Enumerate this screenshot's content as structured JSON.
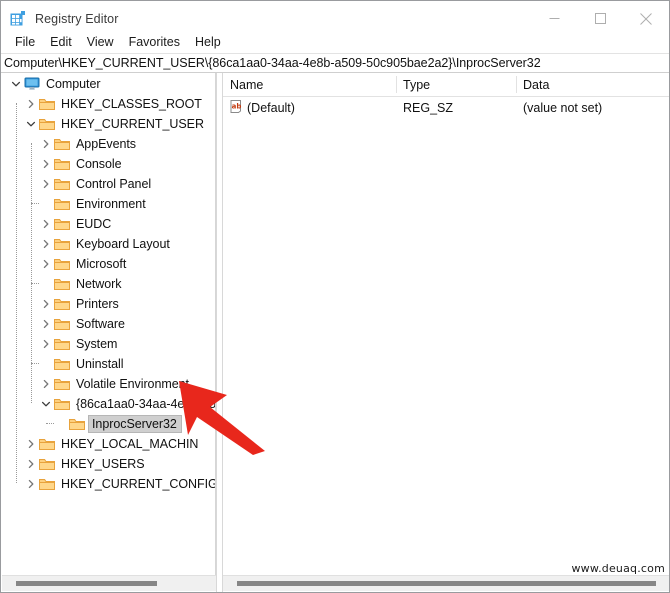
{
  "window": {
    "title": "Registry Editor",
    "app_icon": "registry-grid-icon",
    "minimize_label": "Minimize",
    "maximize_label": "Maximize",
    "close_label": "Close"
  },
  "menu": {
    "items": [
      {
        "label": "File"
      },
      {
        "label": "Edit"
      },
      {
        "label": "View"
      },
      {
        "label": "Favorites"
      },
      {
        "label": "Help"
      }
    ]
  },
  "address": {
    "path": "Computer\\HKEY_CURRENT_USER\\{86ca1aa0-34aa-4e8b-a509-50c905bae2a2}\\InprocServer32"
  },
  "tree": {
    "nodes": [
      {
        "label": "Computer",
        "depth": 0,
        "expander": "expanded",
        "icon": "computer-icon",
        "selected": false
      },
      {
        "label": "HKEY_CLASSES_ROOT",
        "depth": 1,
        "expander": "collapsed",
        "icon": "folder-icon",
        "selected": false
      },
      {
        "label": "HKEY_CURRENT_USER",
        "depth": 1,
        "expander": "expanded",
        "icon": "folder-icon",
        "selected": false
      },
      {
        "label": "AppEvents",
        "depth": 2,
        "expander": "collapsed",
        "icon": "folder-icon",
        "selected": false
      },
      {
        "label": "Console",
        "depth": 2,
        "expander": "collapsed",
        "icon": "folder-icon",
        "selected": false
      },
      {
        "label": "Control Panel",
        "depth": 2,
        "expander": "collapsed",
        "icon": "folder-icon",
        "selected": false
      },
      {
        "label": "Environment",
        "depth": 2,
        "expander": "none",
        "icon": "folder-icon",
        "selected": false
      },
      {
        "label": "EUDC",
        "depth": 2,
        "expander": "collapsed",
        "icon": "folder-icon",
        "selected": false
      },
      {
        "label": "Keyboard Layout",
        "depth": 2,
        "expander": "collapsed",
        "icon": "folder-icon",
        "selected": false
      },
      {
        "label": "Microsoft",
        "depth": 2,
        "expander": "collapsed",
        "icon": "folder-icon",
        "selected": false
      },
      {
        "label": "Network",
        "depth": 2,
        "expander": "none",
        "icon": "folder-icon",
        "selected": false
      },
      {
        "label": "Printers",
        "depth": 2,
        "expander": "collapsed",
        "icon": "folder-icon",
        "selected": false
      },
      {
        "label": "Software",
        "depth": 2,
        "expander": "collapsed",
        "icon": "folder-icon",
        "selected": false
      },
      {
        "label": "System",
        "depth": 2,
        "expander": "collapsed",
        "icon": "folder-icon",
        "selected": false
      },
      {
        "label": "Uninstall",
        "depth": 2,
        "expander": "none",
        "icon": "folder-icon",
        "selected": false
      },
      {
        "label": "Volatile Environment",
        "depth": 2,
        "expander": "collapsed",
        "icon": "folder-icon",
        "selected": false
      },
      {
        "label": "{86ca1aa0-34aa-4e8b-a509-5",
        "depth": 2,
        "expander": "expanded",
        "icon": "folder-icon",
        "selected": false
      },
      {
        "label": "InprocServer32",
        "depth": 3,
        "expander": "none",
        "icon": "folder-icon",
        "selected": true
      },
      {
        "label": "HKEY_LOCAL_MACHIN",
        "depth": 1,
        "expander": "collapsed",
        "icon": "folder-icon",
        "selected": false
      },
      {
        "label": "HKEY_USERS",
        "depth": 1,
        "expander": "collapsed",
        "icon": "folder-icon",
        "selected": false
      },
      {
        "label": "HKEY_CURRENT_CONFIG",
        "depth": 1,
        "expander": "collapsed",
        "icon": "folder-icon",
        "selected": false
      }
    ]
  },
  "values_list": {
    "columns": [
      {
        "label": "Name"
      },
      {
        "label": "Type"
      },
      {
        "label": "Data"
      }
    ],
    "rows": [
      {
        "icon": "string-value-icon",
        "name": "(Default)",
        "type": "REG_SZ",
        "data": "(value not set)"
      }
    ]
  },
  "annotation": {
    "arrow_color": "#e8271c",
    "arrow_target": "InprocServer32"
  },
  "watermark": {
    "text": "www.deuaq.com"
  },
  "colors": {
    "folder": "#fdd07f",
    "folder_edge": "#e8a33d",
    "selection": "#cfcfcf",
    "accent_blue": "#2b8fd6"
  }
}
